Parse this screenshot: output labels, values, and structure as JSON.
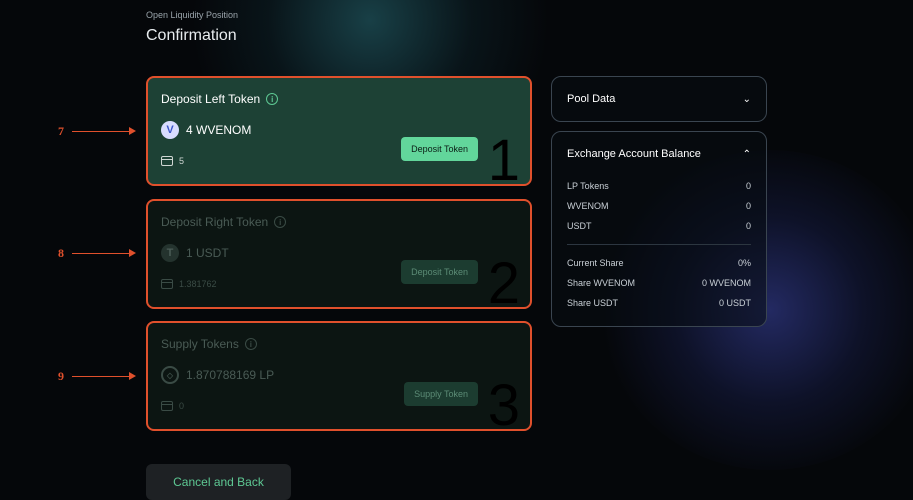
{
  "header": {
    "subtitle": "Open Liquidity Position",
    "title": "Confirmation"
  },
  "cards": [
    {
      "title": "Deposit Left Token",
      "token_amount": "4 WVENOM",
      "wallet_balance": "5",
      "button_label": "Deposit Token",
      "step": "1",
      "annotation": "7",
      "icon": "venom-token-icon"
    },
    {
      "title": "Deposit Right Token",
      "token_amount": "1 USDT",
      "wallet_balance": "1.381762",
      "button_label": "Deposit Token",
      "step": "2",
      "annotation": "8",
      "icon": "usdt-token-icon"
    },
    {
      "title": "Supply Tokens",
      "token_amount": "1.870788169 LP",
      "wallet_balance": "0",
      "button_label": "Supply Token",
      "step": "3",
      "annotation": "9",
      "icon": "lp-token-icon"
    }
  ],
  "pool_data": {
    "title": "Pool Data"
  },
  "exchange_balance": {
    "title": "Exchange Account Balance",
    "rows": [
      {
        "label": "LP Tokens",
        "value": "0"
      },
      {
        "label": "WVENOM",
        "value": "0"
      },
      {
        "label": "USDT",
        "value": "0"
      }
    ],
    "share_rows": [
      {
        "label": "Current Share",
        "value": "0%"
      },
      {
        "label": "Share WVENOM",
        "value": "0 WVENOM"
      },
      {
        "label": "Share USDT",
        "value": "0 USDT"
      }
    ]
  },
  "cancel_label": "Cancel and Back",
  "colors": {
    "accent": "#62d69b",
    "annotation": "#e0502c",
    "card_active": "#1d4135"
  }
}
